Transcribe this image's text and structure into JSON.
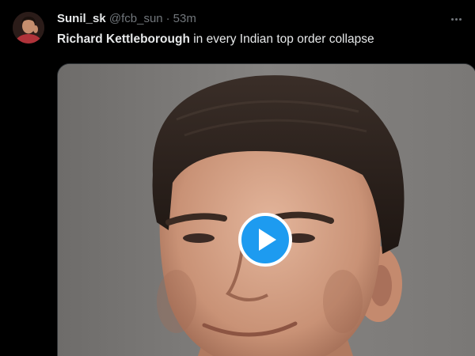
{
  "tweet": {
    "display_name": "Sunil_sk",
    "handle": "@fcb_sun",
    "separator": "·",
    "time": "53m",
    "mention": "Richard Kettleborough",
    "text": " in every Indian top order collapse",
    "more_icon": "more-horizontal-icon",
    "media": {
      "type": "video",
      "play_icon": "play-icon"
    }
  },
  "colors": {
    "background": "#000000",
    "primary_text": "#e7e9ea",
    "secondary_text": "#71767b",
    "accent": "#1d9bf0"
  }
}
